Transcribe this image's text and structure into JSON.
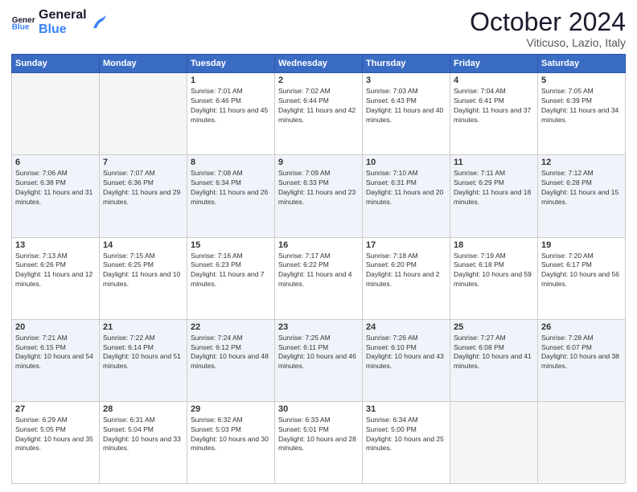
{
  "header": {
    "logo_general": "General",
    "logo_blue": "Blue",
    "month_title": "October 2024",
    "location": "Viticuso, Lazio, Italy"
  },
  "days_of_week": [
    "Sunday",
    "Monday",
    "Tuesday",
    "Wednesday",
    "Thursday",
    "Friday",
    "Saturday"
  ],
  "weeks": [
    [
      null,
      null,
      {
        "day": 1,
        "sunrise": "Sunrise: 7:01 AM",
        "sunset": "Sunset: 6:46 PM",
        "daylight": "Daylight: 11 hours and 45 minutes."
      },
      {
        "day": 2,
        "sunrise": "Sunrise: 7:02 AM",
        "sunset": "Sunset: 6:44 PM",
        "daylight": "Daylight: 11 hours and 42 minutes."
      },
      {
        "day": 3,
        "sunrise": "Sunrise: 7:03 AM",
        "sunset": "Sunset: 6:43 PM",
        "daylight": "Daylight: 11 hours and 40 minutes."
      },
      {
        "day": 4,
        "sunrise": "Sunrise: 7:04 AM",
        "sunset": "Sunset: 6:41 PM",
        "daylight": "Daylight: 11 hours and 37 minutes."
      },
      {
        "day": 5,
        "sunrise": "Sunrise: 7:05 AM",
        "sunset": "Sunset: 6:39 PM",
        "daylight": "Daylight: 11 hours and 34 minutes."
      }
    ],
    [
      {
        "day": 6,
        "sunrise": "Sunrise: 7:06 AM",
        "sunset": "Sunset: 6:38 PM",
        "daylight": "Daylight: 11 hours and 31 minutes."
      },
      {
        "day": 7,
        "sunrise": "Sunrise: 7:07 AM",
        "sunset": "Sunset: 6:36 PM",
        "daylight": "Daylight: 11 hours and 29 minutes."
      },
      {
        "day": 8,
        "sunrise": "Sunrise: 7:08 AM",
        "sunset": "Sunset: 6:34 PM",
        "daylight": "Daylight: 11 hours and 26 minutes."
      },
      {
        "day": 9,
        "sunrise": "Sunrise: 7:09 AM",
        "sunset": "Sunset: 6:33 PM",
        "daylight": "Daylight: 11 hours and 23 minutes."
      },
      {
        "day": 10,
        "sunrise": "Sunrise: 7:10 AM",
        "sunset": "Sunset: 6:31 PM",
        "daylight": "Daylight: 11 hours and 20 minutes."
      },
      {
        "day": 11,
        "sunrise": "Sunrise: 7:11 AM",
        "sunset": "Sunset: 6:29 PM",
        "daylight": "Daylight: 11 hours and 18 minutes."
      },
      {
        "day": 12,
        "sunrise": "Sunrise: 7:12 AM",
        "sunset": "Sunset: 6:28 PM",
        "daylight": "Daylight: 11 hours and 15 minutes."
      }
    ],
    [
      {
        "day": 13,
        "sunrise": "Sunrise: 7:13 AM",
        "sunset": "Sunset: 6:26 PM",
        "daylight": "Daylight: 11 hours and 12 minutes."
      },
      {
        "day": 14,
        "sunrise": "Sunrise: 7:15 AM",
        "sunset": "Sunset: 6:25 PM",
        "daylight": "Daylight: 11 hours and 10 minutes."
      },
      {
        "day": 15,
        "sunrise": "Sunrise: 7:16 AM",
        "sunset": "Sunset: 6:23 PM",
        "daylight": "Daylight: 11 hours and 7 minutes."
      },
      {
        "day": 16,
        "sunrise": "Sunrise: 7:17 AM",
        "sunset": "Sunset: 6:22 PM",
        "daylight": "Daylight: 11 hours and 4 minutes."
      },
      {
        "day": 17,
        "sunrise": "Sunrise: 7:18 AM",
        "sunset": "Sunset: 6:20 PM",
        "daylight": "Daylight: 11 hours and 2 minutes."
      },
      {
        "day": 18,
        "sunrise": "Sunrise: 7:19 AM",
        "sunset": "Sunset: 6:18 PM",
        "daylight": "Daylight: 10 hours and 59 minutes."
      },
      {
        "day": 19,
        "sunrise": "Sunrise: 7:20 AM",
        "sunset": "Sunset: 6:17 PM",
        "daylight": "Daylight: 10 hours and 56 minutes."
      }
    ],
    [
      {
        "day": 20,
        "sunrise": "Sunrise: 7:21 AM",
        "sunset": "Sunset: 6:15 PM",
        "daylight": "Daylight: 10 hours and 54 minutes."
      },
      {
        "day": 21,
        "sunrise": "Sunrise: 7:22 AM",
        "sunset": "Sunset: 6:14 PM",
        "daylight": "Daylight: 10 hours and 51 minutes."
      },
      {
        "day": 22,
        "sunrise": "Sunrise: 7:24 AM",
        "sunset": "Sunset: 6:12 PM",
        "daylight": "Daylight: 10 hours and 48 minutes."
      },
      {
        "day": 23,
        "sunrise": "Sunrise: 7:25 AM",
        "sunset": "Sunset: 6:11 PM",
        "daylight": "Daylight: 10 hours and 46 minutes."
      },
      {
        "day": 24,
        "sunrise": "Sunrise: 7:26 AM",
        "sunset": "Sunset: 6:10 PM",
        "daylight": "Daylight: 10 hours and 43 minutes."
      },
      {
        "day": 25,
        "sunrise": "Sunrise: 7:27 AM",
        "sunset": "Sunset: 6:08 PM",
        "daylight": "Daylight: 10 hours and 41 minutes."
      },
      {
        "day": 26,
        "sunrise": "Sunrise: 7:28 AM",
        "sunset": "Sunset: 6:07 PM",
        "daylight": "Daylight: 10 hours and 38 minutes."
      }
    ],
    [
      {
        "day": 27,
        "sunrise": "Sunrise: 6:29 AM",
        "sunset": "Sunset: 5:05 PM",
        "daylight": "Daylight: 10 hours and 35 minutes."
      },
      {
        "day": 28,
        "sunrise": "Sunrise: 6:31 AM",
        "sunset": "Sunset: 5:04 PM",
        "daylight": "Daylight: 10 hours and 33 minutes."
      },
      {
        "day": 29,
        "sunrise": "Sunrise: 6:32 AM",
        "sunset": "Sunset: 5:03 PM",
        "daylight": "Daylight: 10 hours and 30 minutes."
      },
      {
        "day": 30,
        "sunrise": "Sunrise: 6:33 AM",
        "sunset": "Sunset: 5:01 PM",
        "daylight": "Daylight: 10 hours and 28 minutes."
      },
      {
        "day": 31,
        "sunrise": "Sunrise: 6:34 AM",
        "sunset": "Sunset: 5:00 PM",
        "daylight": "Daylight: 10 hours and 25 minutes."
      },
      null,
      null
    ]
  ]
}
